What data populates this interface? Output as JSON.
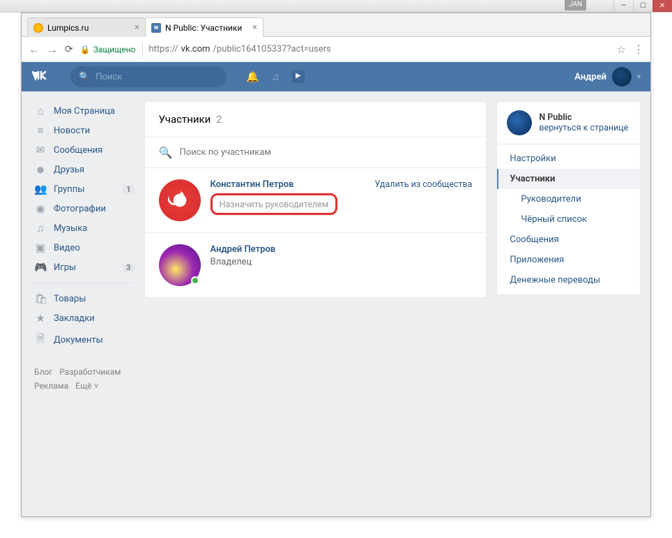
{
  "window": {
    "badge": "JAN"
  },
  "tabs": [
    {
      "title": "Lumpics.ru"
    },
    {
      "title": "N Public: Участники"
    }
  ],
  "addr": {
    "secure": "Защищено",
    "url_prefix": "https://",
    "url_host": "vk.com",
    "url_path": "/public164105337?act=users"
  },
  "vk_header": {
    "search": "Поиск",
    "user": "Андрей"
  },
  "nav": {
    "items": [
      {
        "icon": "⌂",
        "label": "Моя Страница"
      },
      {
        "icon": "≡",
        "label": "Новости"
      },
      {
        "icon": "✉",
        "label": "Сообщения"
      },
      {
        "icon": "☻",
        "label": "Друзья"
      },
      {
        "icon": "👥",
        "label": "Группы",
        "badge": "1"
      },
      {
        "icon": "◉",
        "label": "Фотографии"
      },
      {
        "icon": "♫",
        "label": "Музыка"
      },
      {
        "icon": "▣",
        "label": "Видео"
      },
      {
        "icon": "🎮",
        "label": "Игры",
        "badge": "3"
      }
    ],
    "items2": [
      {
        "icon": "🛍",
        "label": "Товары"
      },
      {
        "icon": "★",
        "label": "Закладки"
      },
      {
        "icon": "🗎",
        "label": "Документы"
      }
    ]
  },
  "footer": {
    "a": "Блог",
    "b": "Разработчикам",
    "c": "Реклама",
    "d": "Ещё ˅"
  },
  "main": {
    "title": "Участники",
    "count": "2",
    "search_placeholder": "Поиск по участникам",
    "members": [
      {
        "name": "Константин Петров",
        "remove": "Удалить из сообщества",
        "assign": "Назначить руководителем"
      },
      {
        "name": "Андрей Петров",
        "role": "Владелец"
      }
    ]
  },
  "right": {
    "title": "N Public",
    "sub": "вернуться к странице",
    "menu": [
      {
        "label": "Настройки"
      },
      {
        "label": "Участники",
        "active": true
      },
      {
        "label": "Руководители",
        "sub": true
      },
      {
        "label": "Чёрный список",
        "sub": true
      },
      {
        "label": "Сообщения"
      },
      {
        "label": "Приложения"
      },
      {
        "label": "Денежные переводы"
      }
    ]
  }
}
